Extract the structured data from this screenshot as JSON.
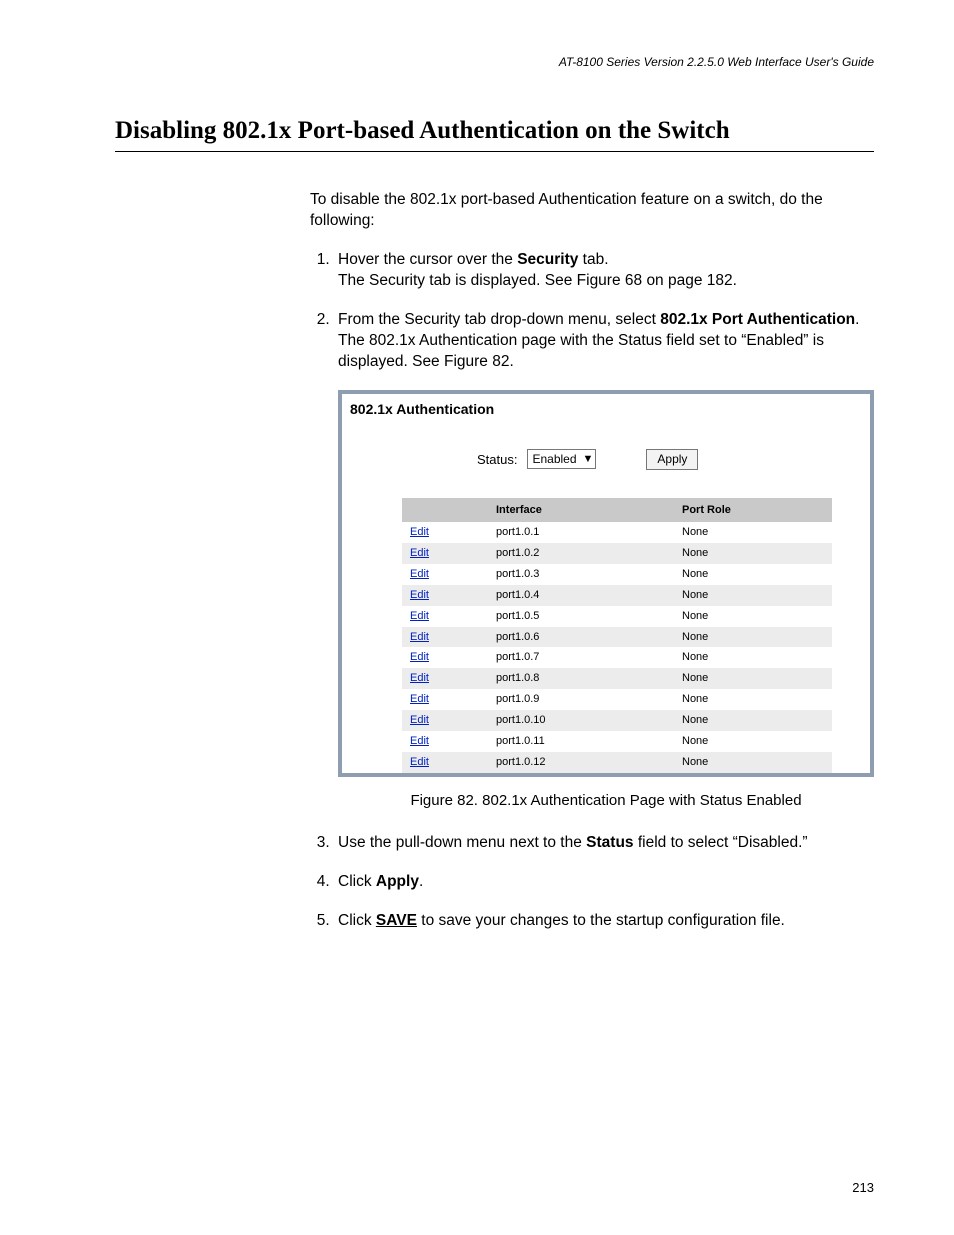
{
  "header": {
    "running_head": "AT-8100 Series Version 2.2.5.0 Web Interface User's Guide"
  },
  "title": "Disabling 802.1x Port-based Authentication on the Switch",
  "intro": "To disable the 802.1x port-based Authentication feature on a switch, do the following:",
  "steps": {
    "s1_a": "Hover the cursor over the ",
    "s1_b": "Security",
    "s1_c": " tab.",
    "s1_follow": "The Security tab is displayed. See Figure 68 on page 182.",
    "s2_a": "From the Security tab drop-down menu, select ",
    "s2_b": "802.1x Port Authentication",
    "s2_c": ".",
    "s2_follow": "The 802.1x Authentication page with the Status field set to “Enabled” is displayed. See Figure 82.",
    "s3_a": "Use the pull-down menu next to the ",
    "s3_b": "Status",
    "s3_c": " field to select “Disabled.”",
    "s4_a": "Click ",
    "s4_b": "Apply",
    "s4_c": ".",
    "s5_a": "Click ",
    "s5_b": "SAVE",
    "s5_c": " to save your changes to the startup configuration file."
  },
  "figure": {
    "panel_title": "802.1x Authentication",
    "status_label": "Status:",
    "status_value": "Enabled",
    "apply_label": "Apply",
    "col_edit": "",
    "col_interface": "Interface",
    "col_portrole": "Port Role",
    "edit_label": "Edit",
    "rows": [
      {
        "interface": "port1.0.1",
        "role": "None"
      },
      {
        "interface": "port1.0.2",
        "role": "None"
      },
      {
        "interface": "port1.0.3",
        "role": "None"
      },
      {
        "interface": "port1.0.4",
        "role": "None"
      },
      {
        "interface": "port1.0.5",
        "role": "None"
      },
      {
        "interface": "port1.0.6",
        "role": "None"
      },
      {
        "interface": "port1.0.7",
        "role": "None"
      },
      {
        "interface": "port1.0.8",
        "role": "None"
      },
      {
        "interface": "port1.0.9",
        "role": "None"
      },
      {
        "interface": "port1.0.10",
        "role": "None"
      },
      {
        "interface": "port1.0.11",
        "role": "None"
      },
      {
        "interface": "port1.0.12",
        "role": "None"
      }
    ],
    "caption": "Figure 82. 802.1x Authentication Page with Status Enabled"
  },
  "page_number": "213"
}
